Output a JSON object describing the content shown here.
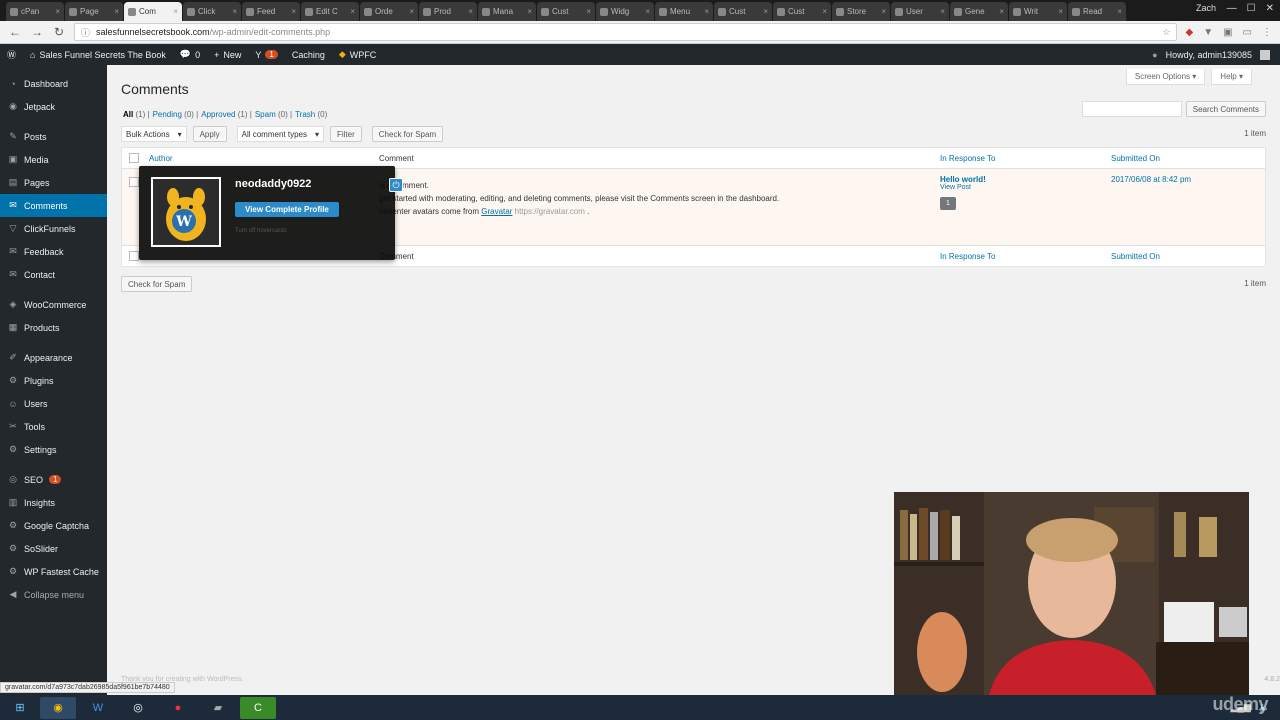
{
  "browser": {
    "tabs": [
      "cPan",
      "Page",
      "Com",
      "Click",
      "Feed",
      "Edit C",
      "Orde",
      "Prod",
      "Mana",
      "Cust",
      "Widg",
      "Menu",
      "Cust",
      "Cust",
      "Store",
      "User",
      "Gene",
      "Writ",
      "Read"
    ],
    "active_tab_index": 2,
    "user": "Zach",
    "url_domain": "salesfunnelsecretsbook.com",
    "url_path": "/wp-admin/edit-comments.php"
  },
  "adminbar": {
    "site_name": "Sales Funnel Secrets The Book",
    "comments_count": "0",
    "new_label": "New",
    "updates_count": "1",
    "caching_label": "Caching",
    "wpfc_label": "WPFC",
    "howdy": "Howdy, admin139085"
  },
  "sidebar": {
    "items": [
      {
        "label": "Dashboard",
        "icon": "dashboard-icon",
        "glyph": "◔"
      },
      {
        "label": "Jetpack",
        "icon": "jetpack-icon",
        "glyph": "◉"
      },
      {
        "sep": true
      },
      {
        "label": "Posts",
        "icon": "pin-icon",
        "glyph": "✎"
      },
      {
        "label": "Media",
        "icon": "media-icon",
        "glyph": "▣"
      },
      {
        "label": "Pages",
        "icon": "page-icon",
        "glyph": "▤"
      },
      {
        "label": "Comments",
        "icon": "comment-icon",
        "glyph": "✉",
        "current": true
      },
      {
        "label": "ClickFunnels",
        "icon": "funnel-icon",
        "glyph": "▽"
      },
      {
        "label": "Feedback",
        "icon": "feedback-icon",
        "glyph": "✉"
      },
      {
        "label": "Contact",
        "icon": "contact-icon",
        "glyph": "✉"
      },
      {
        "sep": true
      },
      {
        "label": "WooCommerce",
        "icon": "woocommerce-icon",
        "glyph": "◈"
      },
      {
        "label": "Products",
        "icon": "products-icon",
        "glyph": "▦"
      },
      {
        "sep": true
      },
      {
        "label": "Appearance",
        "icon": "appearance-icon",
        "glyph": "✐"
      },
      {
        "label": "Plugins",
        "icon": "plugin-icon",
        "glyph": "⚙"
      },
      {
        "label": "Users",
        "icon": "user-icon",
        "glyph": "☺"
      },
      {
        "label": "Tools",
        "icon": "tools-icon",
        "glyph": "✂"
      },
      {
        "label": "Settings",
        "icon": "settings-icon",
        "glyph": "⚙"
      },
      {
        "sep": true
      },
      {
        "label": "SEO",
        "icon": "seo-icon",
        "glyph": "◎",
        "badge": "1"
      },
      {
        "label": "Insights",
        "icon": "insights-icon",
        "glyph": "▥"
      },
      {
        "label": "Google Captcha",
        "icon": "captcha-icon",
        "glyph": "⚙"
      },
      {
        "label": "SoSlider",
        "icon": "slider-icon",
        "glyph": "⚙"
      },
      {
        "label": "WP Fastest Cache",
        "icon": "cache-icon",
        "glyph": "⚙"
      },
      {
        "label": "Collapse menu",
        "icon": "collapse-icon",
        "glyph": "◀",
        "collapse": true
      }
    ]
  },
  "main": {
    "screen_options": "Screen Options ▾",
    "help": "Help ▾",
    "title": "Comments",
    "filters": [
      {
        "label": "All",
        "count": "(1)",
        "current": true
      },
      {
        "label": "Pending",
        "count": "(0)"
      },
      {
        "label": "Approved",
        "count": "(1)"
      },
      {
        "label": "Spam",
        "count": "(0)"
      },
      {
        "label": "Trash",
        "count": "(0)"
      }
    ],
    "search_button": "Search Comments",
    "bulk_actions": "Bulk Actions",
    "apply": "Apply",
    "comment_types": "All comment types",
    "filter": "Filter",
    "check_spam": "Check for Spam",
    "items_count": "1 item",
    "columns": {
      "author": "Author",
      "comment": "Comment",
      "response": "In Response To",
      "submitted": "Submitted On"
    },
    "row": {
      "comment_line1": "is a comment.",
      "comment_line2": "get started with moderating, editing, and deleting comments, please visit the Comments screen in the dashboard.",
      "comment_line3": "mmenter avatars come from",
      "gravatar_link": "Gravatar",
      "gravatar_url": "https://gravatar.com",
      "response_post": "Hello world!",
      "view_post": "View Post",
      "count": "1",
      "submitted": "2017/06/08 at 8:42 pm"
    },
    "footer": "Thank you for creating with WordPress.",
    "version": "4.8.2"
  },
  "hovercard": {
    "name": "neodaddy0922",
    "button": "View Complete Profile",
    "turn_off": "Turn off hovercards"
  },
  "status_url": "gravatar.com/d7a973c7dab26985da5f961be7b74480",
  "watermark": "udemy"
}
